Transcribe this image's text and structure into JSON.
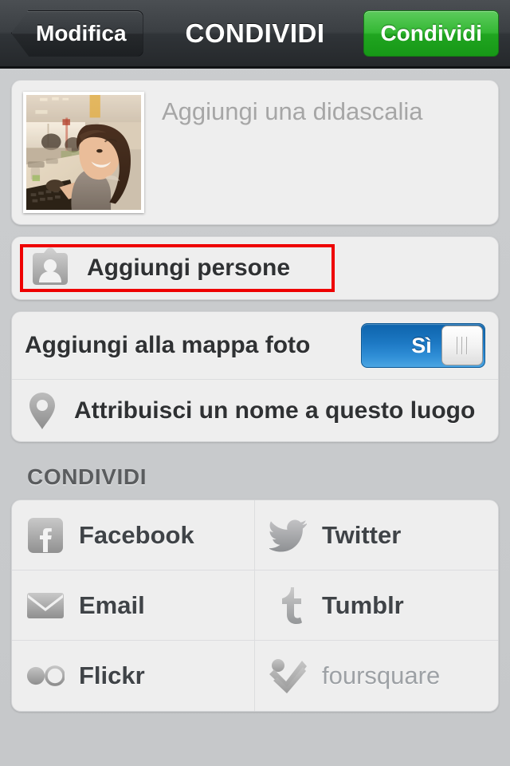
{
  "navbar": {
    "back_label": "Modifica",
    "title": "CONDIVIDI",
    "share_label": "Condividi"
  },
  "caption": {
    "placeholder": "Aggiungi una didascalia",
    "thumbnail_alt": "photo-thumbnail"
  },
  "people": {
    "label": "Aggiungi persone",
    "highlighted": true,
    "highlight_color": "#ee0000"
  },
  "map": {
    "label": "Aggiungi alla mappa foto",
    "toggle_value": "Sì",
    "toggle_on": true,
    "toggle_color": "#1d79c4",
    "place_label": "Attribuisci un nome a questo luogo"
  },
  "share_section": {
    "header": "CONDIVIDI",
    "services": [
      {
        "name": "Facebook",
        "icon": "facebook-icon",
        "enabled": true
      },
      {
        "name": "Twitter",
        "icon": "twitter-icon",
        "enabled": true
      },
      {
        "name": "Email",
        "icon": "email-icon",
        "enabled": true
      },
      {
        "name": "Tumblr",
        "icon": "tumblr-icon",
        "enabled": true
      },
      {
        "name": "Flickr",
        "icon": "flickr-icon",
        "enabled": true
      },
      {
        "name": "foursquare",
        "icon": "foursquare-icon",
        "enabled": false
      }
    ]
  }
}
